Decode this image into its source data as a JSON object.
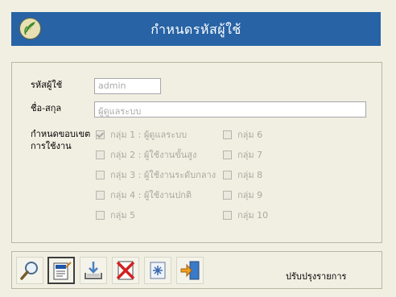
{
  "header": {
    "title": "กำหนดรหัสผู้ใช้"
  },
  "form": {
    "user_id_label": "รหัสผู้ใช้",
    "user_id_value": "admin",
    "full_name_label": "ชื่อ-สกุล",
    "full_name_value": "ผู้ดูแลระบบ",
    "scope_label_line1": "กำหนดขอบเขต",
    "scope_label_line2": "การใช้งาน",
    "groups_left": [
      {
        "label": "กลุ่ม 1 : ผู้ดูแลระบบ",
        "checked": true
      },
      {
        "label": "กลุ่ม 2 : ผู้ใช้งานขั้นสูง",
        "checked": false
      },
      {
        "label": "กลุ่ม 3 : ผู้ใช้งานระดับกลาง",
        "checked": false
      },
      {
        "label": "กลุ่ม 4 : ผู้ใช้งานปกติ",
        "checked": false
      },
      {
        "label": "กลุ่ม 5",
        "checked": false
      }
    ],
    "groups_right": [
      {
        "label": "กลุ่ม 6",
        "checked": false
      },
      {
        "label": "กลุ่ม 7",
        "checked": false
      },
      {
        "label": "กลุ่ม 8",
        "checked": false
      },
      {
        "label": "กลุ่ม 9",
        "checked": false
      },
      {
        "label": "กลุ่ม 10",
        "checked": false
      }
    ]
  },
  "toolbar": {
    "buttons": [
      "search-icon",
      "edit-icon",
      "save-icon",
      "delete-icon",
      "refresh-icon",
      "exit-icon"
    ],
    "status": "ปรับปรุงรายการ"
  },
  "colors": {
    "header_bg": "#2763a5",
    "panel_bg": "#f1efe2",
    "delete_red": "#d42020"
  }
}
